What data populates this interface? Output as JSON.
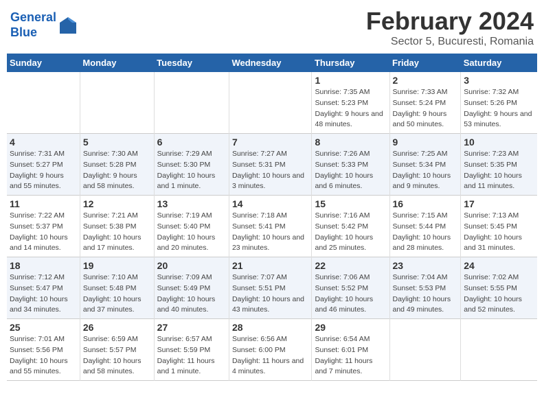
{
  "logo": {
    "line1": "General",
    "line2": "Blue"
  },
  "title": "February 2024",
  "subtitle": "Sector 5, Bucuresti, Romania",
  "days_of_week": [
    "Sunday",
    "Monday",
    "Tuesday",
    "Wednesday",
    "Thursday",
    "Friday",
    "Saturday"
  ],
  "weeks": [
    [
      {
        "day": "",
        "detail": ""
      },
      {
        "day": "",
        "detail": ""
      },
      {
        "day": "",
        "detail": ""
      },
      {
        "day": "",
        "detail": ""
      },
      {
        "day": "1",
        "detail": "Sunrise: 7:35 AM\nSunset: 5:23 PM\nDaylight: 9 hours and 48 minutes."
      },
      {
        "day": "2",
        "detail": "Sunrise: 7:33 AM\nSunset: 5:24 PM\nDaylight: 9 hours and 50 minutes."
      },
      {
        "day": "3",
        "detail": "Sunrise: 7:32 AM\nSunset: 5:26 PM\nDaylight: 9 hours and 53 minutes."
      }
    ],
    [
      {
        "day": "4",
        "detail": "Sunrise: 7:31 AM\nSunset: 5:27 PM\nDaylight: 9 hours and 55 minutes."
      },
      {
        "day": "5",
        "detail": "Sunrise: 7:30 AM\nSunset: 5:28 PM\nDaylight: 9 hours and 58 minutes."
      },
      {
        "day": "6",
        "detail": "Sunrise: 7:29 AM\nSunset: 5:30 PM\nDaylight: 10 hours and 1 minute."
      },
      {
        "day": "7",
        "detail": "Sunrise: 7:27 AM\nSunset: 5:31 PM\nDaylight: 10 hours and 3 minutes."
      },
      {
        "day": "8",
        "detail": "Sunrise: 7:26 AM\nSunset: 5:33 PM\nDaylight: 10 hours and 6 minutes."
      },
      {
        "day": "9",
        "detail": "Sunrise: 7:25 AM\nSunset: 5:34 PM\nDaylight: 10 hours and 9 minutes."
      },
      {
        "day": "10",
        "detail": "Sunrise: 7:23 AM\nSunset: 5:35 PM\nDaylight: 10 hours and 11 minutes."
      }
    ],
    [
      {
        "day": "11",
        "detail": "Sunrise: 7:22 AM\nSunset: 5:37 PM\nDaylight: 10 hours and 14 minutes."
      },
      {
        "day": "12",
        "detail": "Sunrise: 7:21 AM\nSunset: 5:38 PM\nDaylight: 10 hours and 17 minutes."
      },
      {
        "day": "13",
        "detail": "Sunrise: 7:19 AM\nSunset: 5:40 PM\nDaylight: 10 hours and 20 minutes."
      },
      {
        "day": "14",
        "detail": "Sunrise: 7:18 AM\nSunset: 5:41 PM\nDaylight: 10 hours and 23 minutes."
      },
      {
        "day": "15",
        "detail": "Sunrise: 7:16 AM\nSunset: 5:42 PM\nDaylight: 10 hours and 25 minutes."
      },
      {
        "day": "16",
        "detail": "Sunrise: 7:15 AM\nSunset: 5:44 PM\nDaylight: 10 hours and 28 minutes."
      },
      {
        "day": "17",
        "detail": "Sunrise: 7:13 AM\nSunset: 5:45 PM\nDaylight: 10 hours and 31 minutes."
      }
    ],
    [
      {
        "day": "18",
        "detail": "Sunrise: 7:12 AM\nSunset: 5:47 PM\nDaylight: 10 hours and 34 minutes."
      },
      {
        "day": "19",
        "detail": "Sunrise: 7:10 AM\nSunset: 5:48 PM\nDaylight: 10 hours and 37 minutes."
      },
      {
        "day": "20",
        "detail": "Sunrise: 7:09 AM\nSunset: 5:49 PM\nDaylight: 10 hours and 40 minutes."
      },
      {
        "day": "21",
        "detail": "Sunrise: 7:07 AM\nSunset: 5:51 PM\nDaylight: 10 hours and 43 minutes."
      },
      {
        "day": "22",
        "detail": "Sunrise: 7:06 AM\nSunset: 5:52 PM\nDaylight: 10 hours and 46 minutes."
      },
      {
        "day": "23",
        "detail": "Sunrise: 7:04 AM\nSunset: 5:53 PM\nDaylight: 10 hours and 49 minutes."
      },
      {
        "day": "24",
        "detail": "Sunrise: 7:02 AM\nSunset: 5:55 PM\nDaylight: 10 hours and 52 minutes."
      }
    ],
    [
      {
        "day": "25",
        "detail": "Sunrise: 7:01 AM\nSunset: 5:56 PM\nDaylight: 10 hours and 55 minutes."
      },
      {
        "day": "26",
        "detail": "Sunrise: 6:59 AM\nSunset: 5:57 PM\nDaylight: 10 hours and 58 minutes."
      },
      {
        "day": "27",
        "detail": "Sunrise: 6:57 AM\nSunset: 5:59 PM\nDaylight: 11 hours and 1 minute."
      },
      {
        "day": "28",
        "detail": "Sunrise: 6:56 AM\nSunset: 6:00 PM\nDaylight: 11 hours and 4 minutes."
      },
      {
        "day": "29",
        "detail": "Sunrise: 6:54 AM\nSunset: 6:01 PM\nDaylight: 11 hours and 7 minutes."
      },
      {
        "day": "",
        "detail": ""
      },
      {
        "day": "",
        "detail": ""
      }
    ]
  ]
}
